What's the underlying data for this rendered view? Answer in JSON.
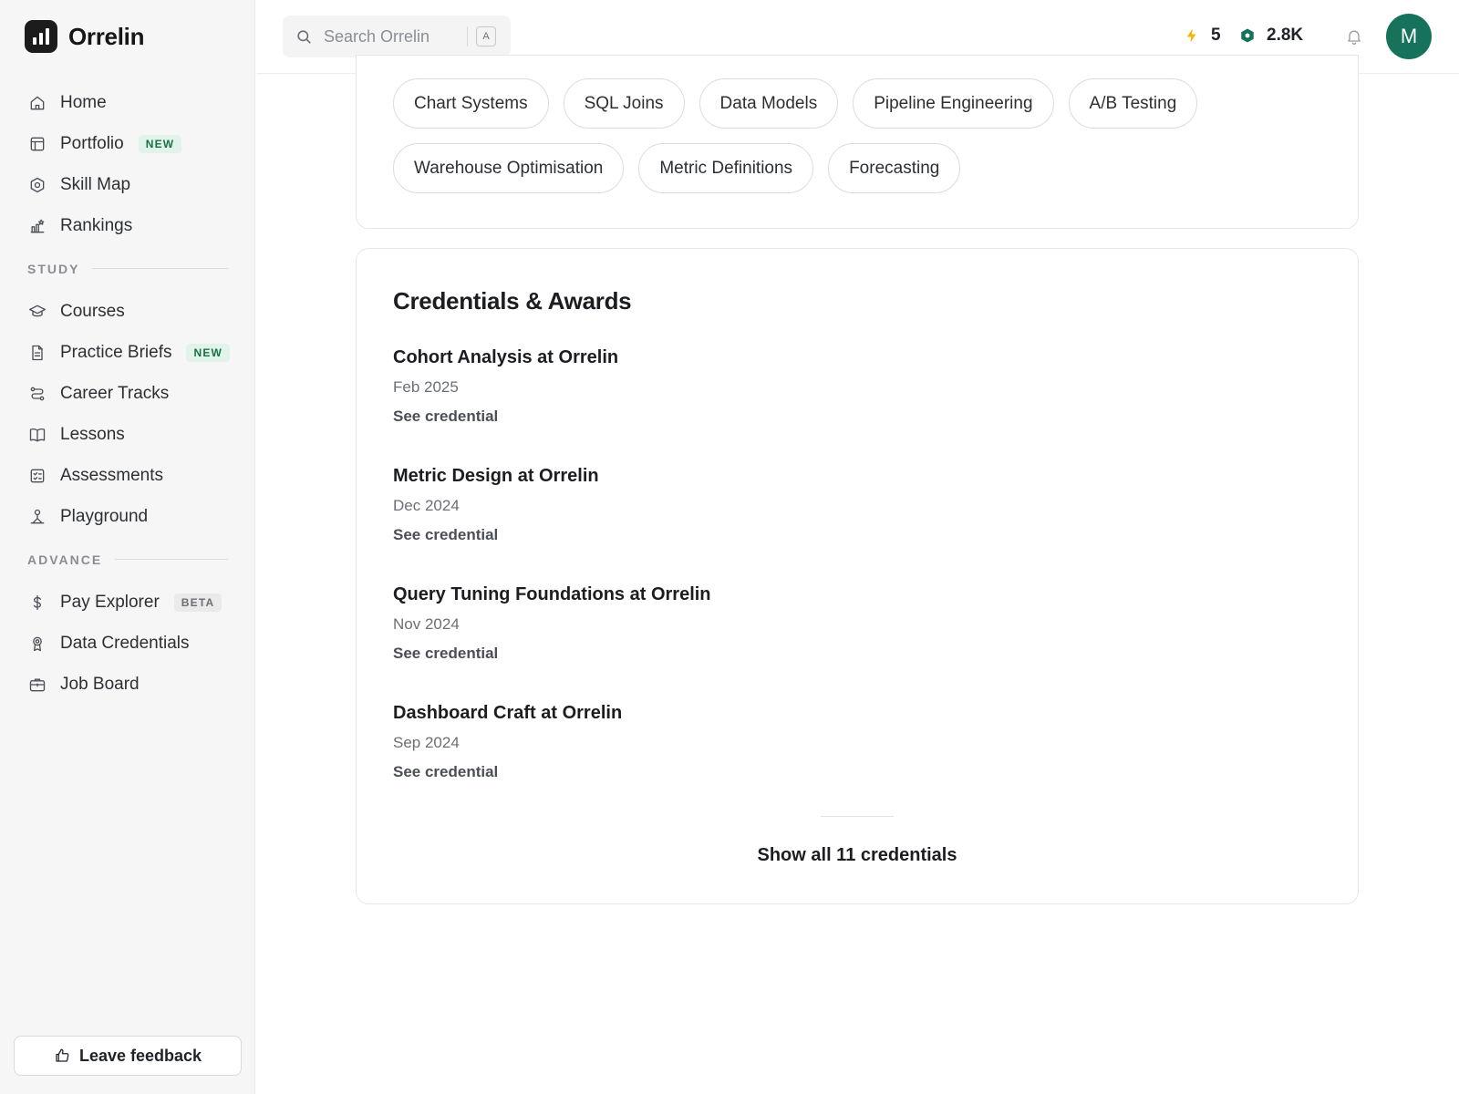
{
  "app": {
    "name": "Orrelin"
  },
  "sidebar": {
    "items": [
      {
        "label": "Home",
        "icon": "home-icon"
      },
      {
        "label": "Portfolio",
        "icon": "layout-icon",
        "badge": "NEW"
      },
      {
        "label": "Skill Map",
        "icon": "hexagon-icon"
      },
      {
        "label": "Rankings",
        "icon": "ranking-icon"
      }
    ],
    "study_label": "STUDY",
    "study_items": [
      {
        "label": "Courses",
        "icon": "graduation-cap-icon"
      },
      {
        "label": "Practice Briefs",
        "icon": "document-icon",
        "badge": "NEW"
      },
      {
        "label": "Career Tracks",
        "icon": "route-icon"
      },
      {
        "label": "Lessons",
        "icon": "book-open-icon"
      },
      {
        "label": "Assessments",
        "icon": "checklist-icon"
      },
      {
        "label": "Playground",
        "icon": "playground-icon"
      }
    ],
    "advance_label": "ADVANCE",
    "advance_items": [
      {
        "label": "Pay Explorer",
        "icon": "dollar-icon",
        "badge": "BETA"
      },
      {
        "label": "Data Credentials",
        "icon": "award-icon"
      },
      {
        "label": "Job Board",
        "icon": "briefcase-icon"
      }
    ],
    "feedback_label": "Leave feedback"
  },
  "topbar": {
    "search_placeholder": "Search Orrelin",
    "search_shortcut": "A",
    "streak": "5",
    "gems": "2.8K",
    "avatar_initial": "M"
  },
  "skills": [
    "Chart Systems",
    "SQL Joins",
    "Data Models",
    "Pipeline Engineering",
    "A/B Testing",
    "Warehouse Optimisation",
    "Metric Definitions",
    "Forecasting"
  ],
  "credentials": {
    "title": "Credentials & Awards",
    "items": [
      {
        "name": "Cohort Analysis at Orrelin",
        "date": "Feb 2025",
        "link": "See credential"
      },
      {
        "name": "Metric Design at Orrelin",
        "date": "Dec 2024",
        "link": "See credential"
      },
      {
        "name": "Query Tuning Foundations at Orrelin",
        "date": "Nov 2024",
        "link": "See credential"
      },
      {
        "name": "Dashboard Craft at Orrelin",
        "date": "Sep 2024",
        "link": "See credential"
      }
    ],
    "show_all": "Show all 11 credentials"
  },
  "colors": {
    "accent": "#17725b",
    "badge_new_bg": "#e2f3ea",
    "badge_new_text": "#16704b",
    "streak": "#f2b705",
    "gem": "#17725b"
  }
}
